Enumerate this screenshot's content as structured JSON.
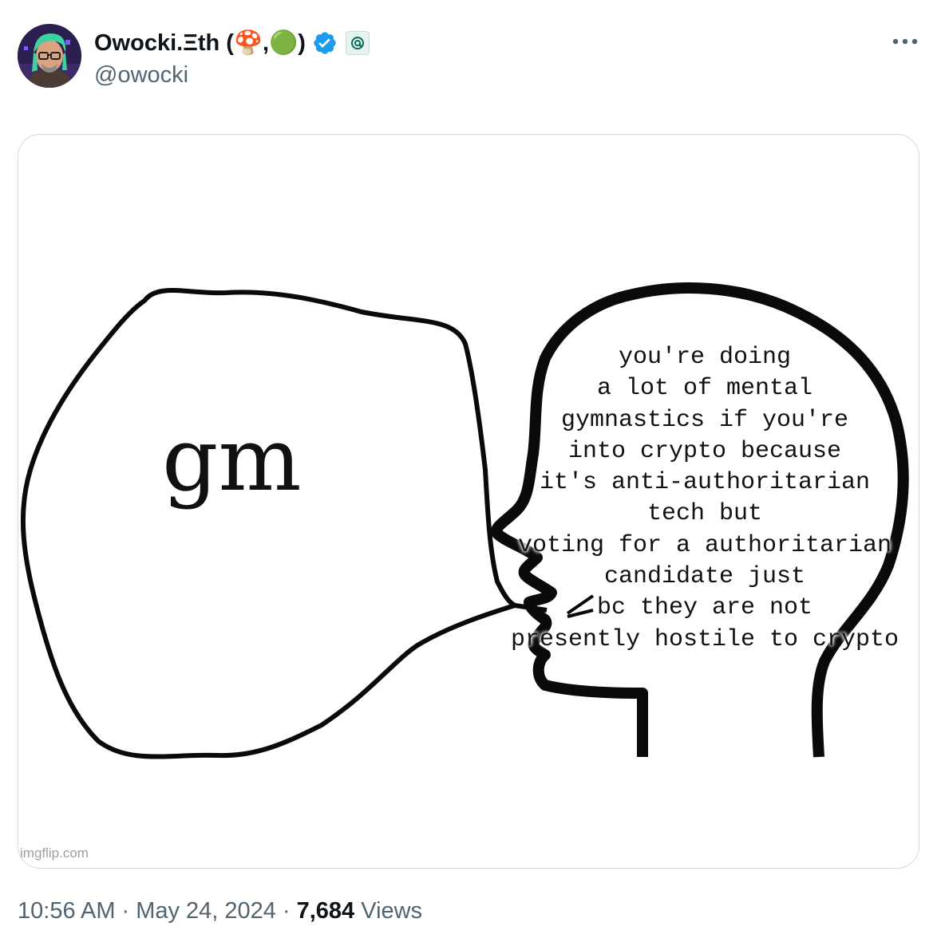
{
  "tweet": {
    "author": {
      "display_name": "Owocki.Ξth (🍄,🟢)",
      "handle": "@owocki",
      "avatar_icon": "avatar-cartoon-green-hair",
      "verified_color": "#1d9bf0"
    },
    "more_icon": "more-horizontal-icon",
    "media": {
      "meme": {
        "speech_text": "gm",
        "thought_text": "you're doing\na lot of mental\ngymnastics if you're\ninto crypto because\nit's anti-authoritarian\ntech but\nvoting for a authoritarian\ncandidate just\nbc they are not\npresently hostile to crypto",
        "watermark": "imgflip.com"
      }
    },
    "meta": {
      "time": "10:56 AM",
      "separator": "·",
      "date": "May 24, 2024",
      "views_count": "7,684",
      "views_label": "Views"
    }
  }
}
